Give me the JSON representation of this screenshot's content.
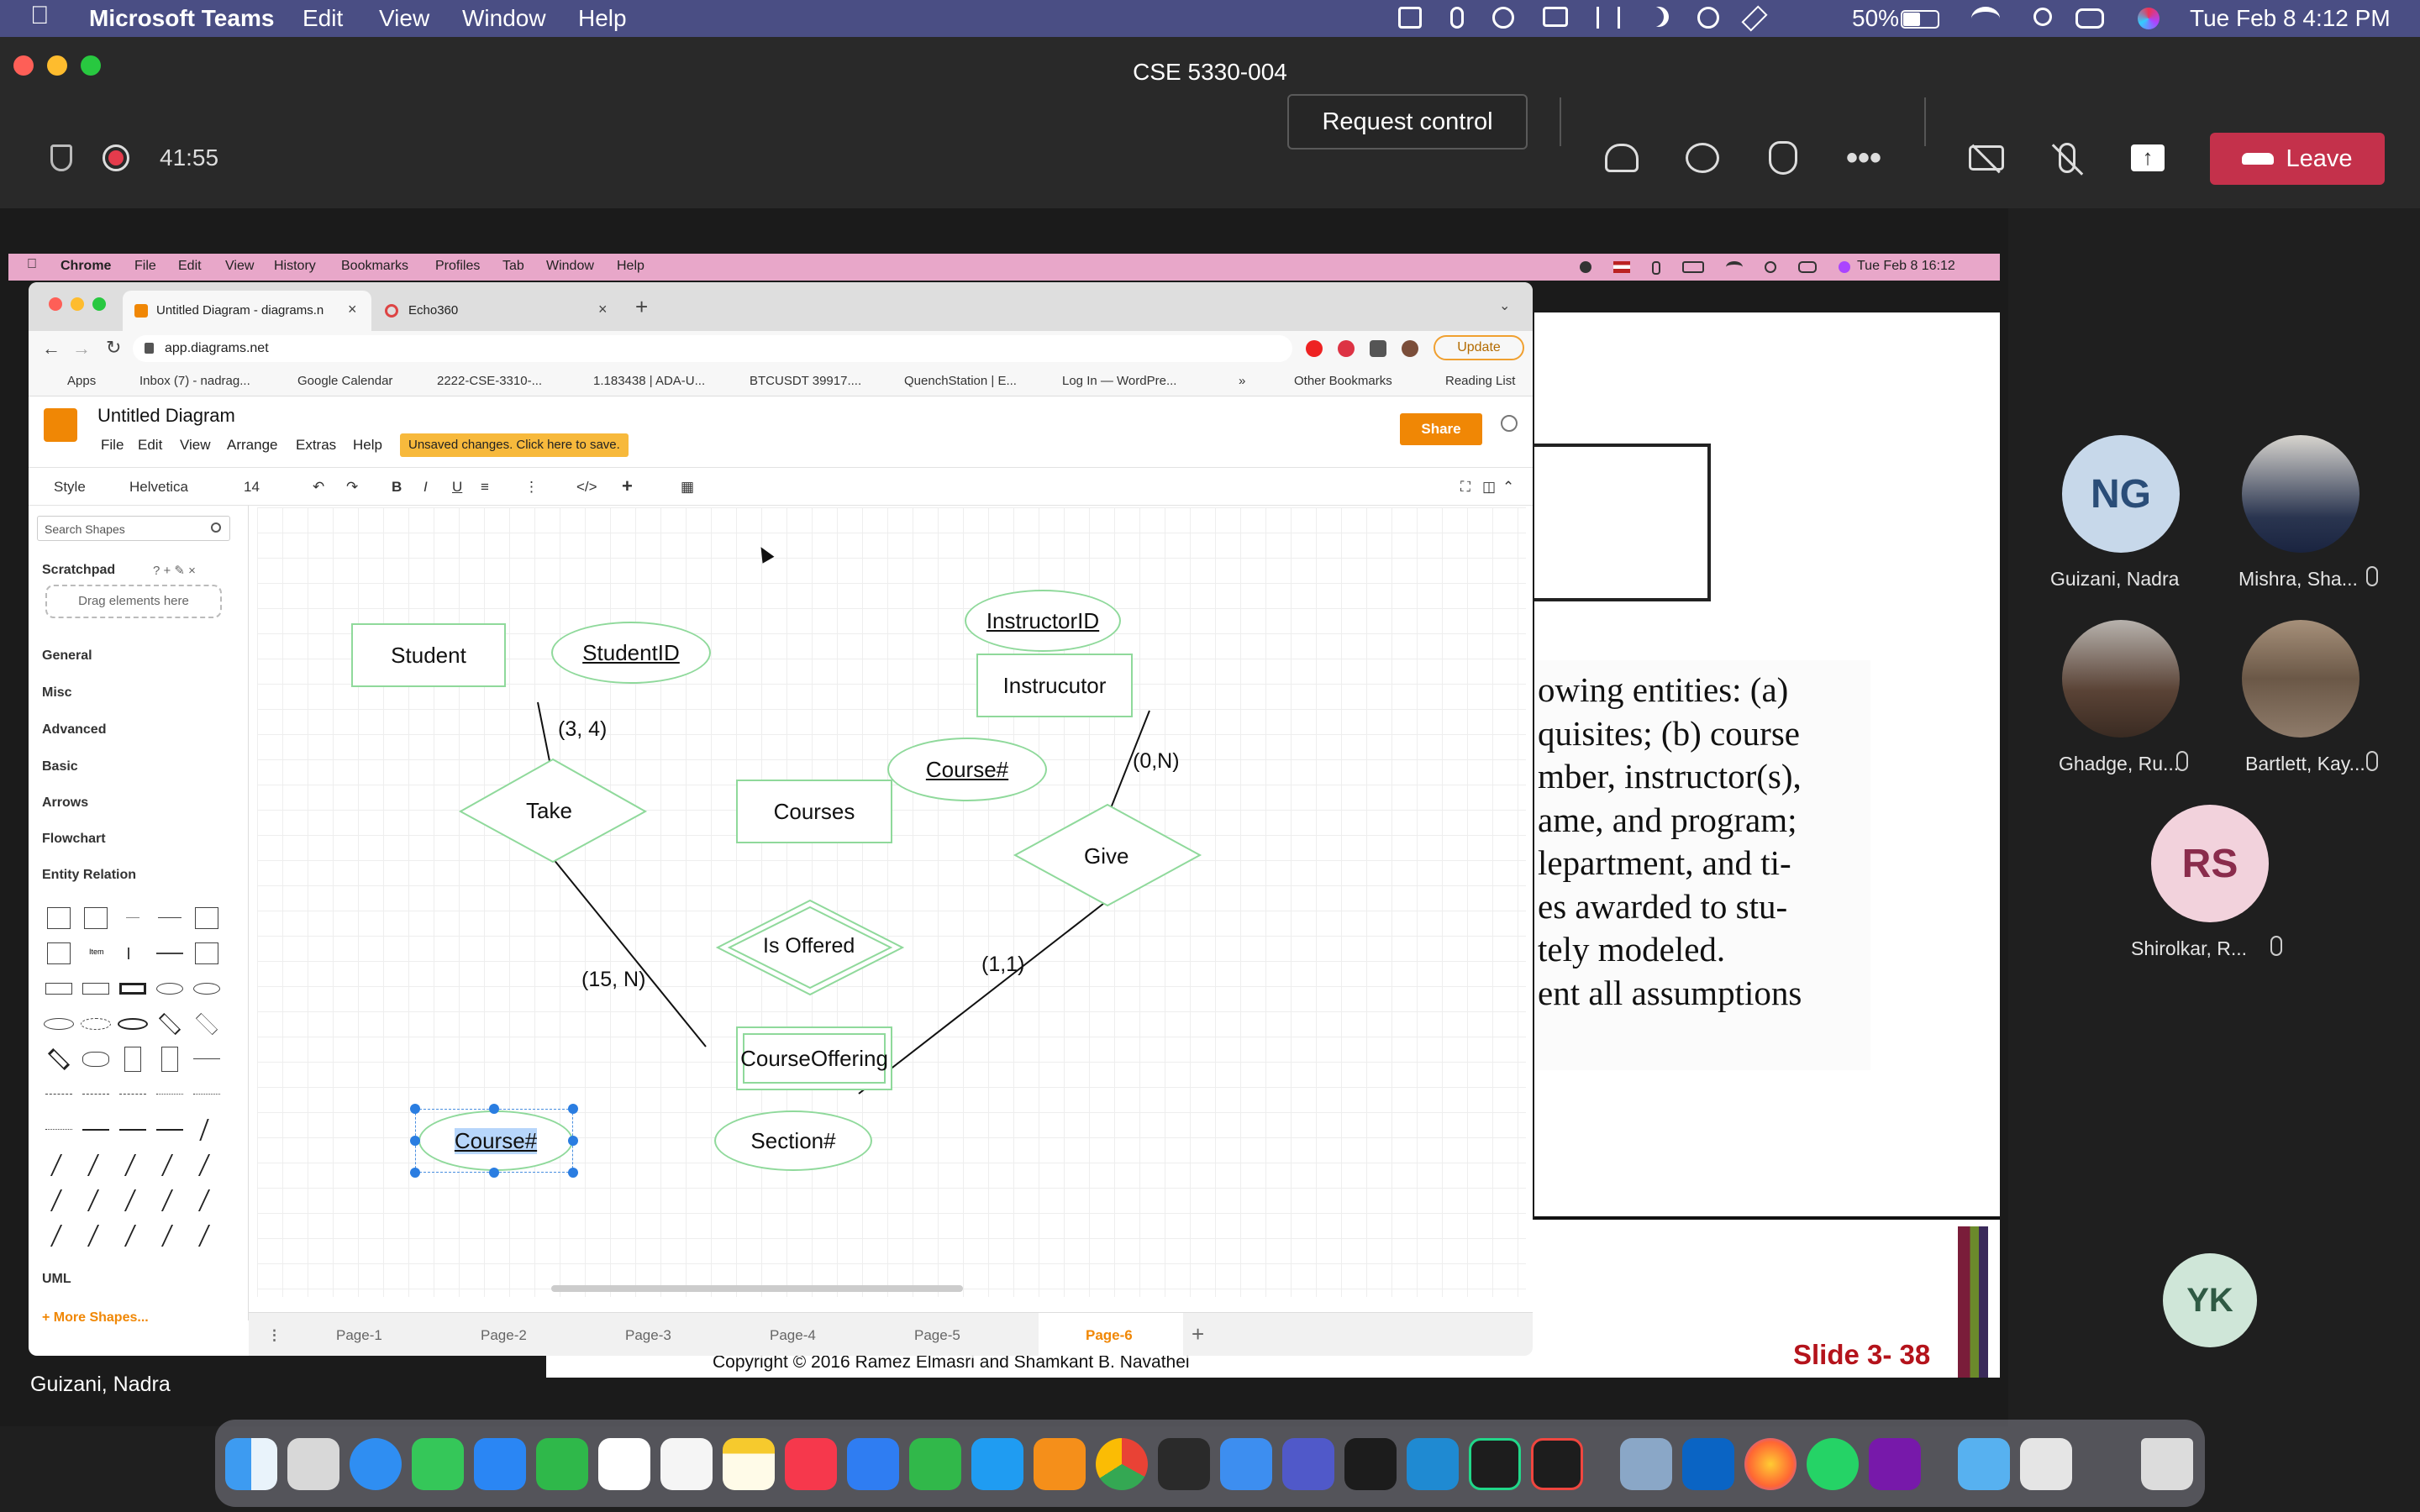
{
  "macbar": {
    "app": "Microsoft Teams",
    "menus": [
      "Edit",
      "View",
      "Window",
      "Help"
    ],
    "battery": "50%",
    "clock": "Tue Feb 8  4:12 PM"
  },
  "teams": {
    "title": "CSE 5330-004",
    "timer": "41:55",
    "request_control": "Request control",
    "leave": "Leave"
  },
  "participants": [
    {
      "name": "Guizani, Nadra",
      "initials": "NG"
    },
    {
      "name": "Mishra, Sha..."
    },
    {
      "name": "Ghadge, Ru..."
    },
    {
      "name": "Bartlett, Kay..."
    },
    {
      "name": "Shirolkar, R...",
      "initials": "RS"
    },
    {
      "initials": "YK"
    }
  ],
  "presenter": "Guizani, Nadra",
  "shared": {
    "menubar": {
      "app": "Chrome",
      "menus": [
        "File",
        "Edit",
        "View",
        "History",
        "Bookmarks",
        "Profiles",
        "Tab",
        "Window",
        "Help"
      ],
      "clock": "Tue Feb 8  16:12"
    },
    "tabs": [
      "Untitled Diagram - diagrams.n",
      "Echo360"
    ],
    "url": "app.diagrams.net",
    "update": "Update",
    "bookmarks": [
      "Apps",
      "Inbox (7) - nadrag...",
      "Google Calendar",
      "2222-CSE-3310-...",
      "1.183438 | ADA-U...",
      "BTCUSDT 39917....",
      "QuenchStation | E...",
      "Log In — WordPre...",
      "»",
      "Other Bookmarks",
      "Reading List"
    ],
    "doc_title": "Untitled Diagram",
    "menus": [
      "File",
      "Edit",
      "View",
      "Arrange",
      "Extras",
      "Help"
    ],
    "unsaved": "Unsaved changes. Click here to save.",
    "share": "Share",
    "toolbar": {
      "style": "Style",
      "font": "Helvetica",
      "size": "14"
    },
    "search_placeholder": "Search Shapes",
    "scratchpad": "Scratchpad",
    "drag_here": "Drag elements here",
    "sections": [
      "General",
      "Misc",
      "Advanced",
      "Basic",
      "Arrows",
      "Flowchart",
      "Entity Relation"
    ],
    "uml": "UML",
    "more_shapes": "+ More Shapes...",
    "pages": [
      "Page-1",
      "Page-2",
      "Page-3",
      "Page-4",
      "Page-5",
      "Page-6"
    ],
    "diagram": {
      "student": "Student",
      "studentid": "StudentID",
      "instructorid": "InstructorID",
      "instructor": "Instrucutor",
      "take": "Take",
      "courses": "Courses",
      "course_num": "Course#",
      "give": "Give",
      "is_offered": "Is Offered",
      "courseoffering": "CourseOffering",
      "course_num2": "Course#",
      "section": "Section#",
      "card_34": "(3, 4)",
      "card_0n": "(0,N)",
      "card_15n": "(15, N)",
      "card_11": "(1,1)"
    },
    "slide_lines": [
      "owing entities: (a)",
      "quisites; (b) course",
      "mber, instructor(s),",
      "ame, and program;",
      "lepartment, and ti-",
      "es awarded to stu-",
      "tely modeled.",
      "ent all assumptions"
    ],
    "copyright": "Copyright © 2016 Ramez Elmasri and Shamkant B. Navathei",
    "slide_no": "Slide 3- 38"
  }
}
